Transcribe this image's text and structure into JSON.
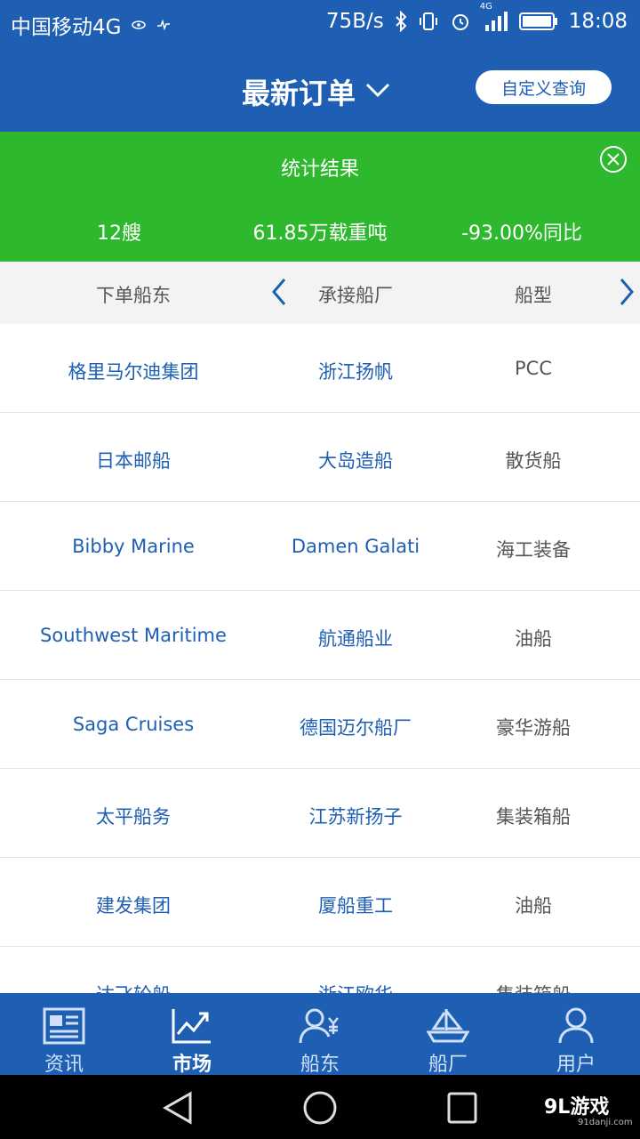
{
  "status": {
    "carrier": "中国移动4G",
    "speed": "75B/s",
    "network": "4G",
    "time": "18:08"
  },
  "header": {
    "title": "最新订单",
    "custom_query": "自定义查询"
  },
  "stats": {
    "title": "统计结果",
    "ships": "12艘",
    "tonnage": "61.85万载重吨",
    "yoy": "-93.00%同比"
  },
  "columns": {
    "owner": "下单船东",
    "builder": "承接船厂",
    "type": "船型"
  },
  "rows": [
    {
      "owner": "格里马尔迪集团",
      "builder": "浙江扬帆",
      "type": "PCC"
    },
    {
      "owner": "日本邮船",
      "builder": "大岛造船",
      "type": "散货船"
    },
    {
      "owner": "Bibby Marine",
      "builder": "Damen Galati",
      "type": "海工装备"
    },
    {
      "owner": "Southwest Maritime",
      "builder": "航通船业",
      "type": "油船"
    },
    {
      "owner": "Saga Cruises",
      "builder": "德国迈尔船厂",
      "type": "豪华游船"
    },
    {
      "owner": "太平船务",
      "builder": "江苏新扬子",
      "type": "集装箱船"
    },
    {
      "owner": "建发集团",
      "builder": "厦船重工",
      "type": "油船"
    },
    {
      "owner": "达飞轮船",
      "builder": "浙江欧华",
      "type": "集装箱船"
    }
  ],
  "tabs": [
    {
      "label": "资讯",
      "icon": "news-icon"
    },
    {
      "label": "市场",
      "icon": "chart-icon"
    },
    {
      "label": "船东",
      "icon": "shipowner-icon"
    },
    {
      "label": "船厂",
      "icon": "shipyard-icon"
    },
    {
      "label": "用户",
      "icon": "user-icon"
    }
  ],
  "active_tab": "市场",
  "watermark": {
    "brand": "9L游戏",
    "site": "91danji.com"
  },
  "colors": {
    "primary": "#1e5fb3",
    "stats_green": "#2db82d"
  }
}
